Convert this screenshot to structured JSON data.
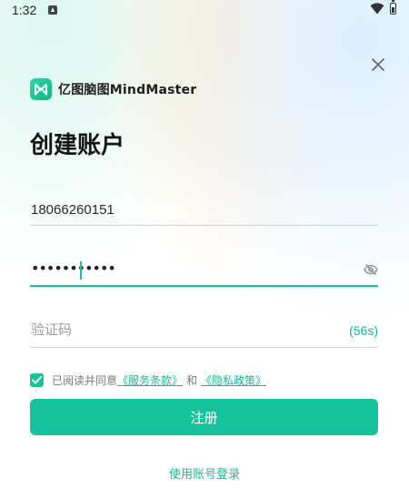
{
  "status_bar": {
    "time": "1:32",
    "icons": [
      "notification-icon",
      "wifi-icon",
      "battery-icon"
    ]
  },
  "header": {
    "close_icon": "close-icon",
    "logo_text": "亿图脑图MindMaster",
    "logo_icon": "mindmaster-logo-icon"
  },
  "title": "创建账户",
  "phone": {
    "value": "18066260151"
  },
  "password": {
    "masked_value": "•••••••••••",
    "toggle_icon": "eye-off-icon"
  },
  "verification": {
    "placeholder": "验证码",
    "countdown": "(56s)"
  },
  "agreement": {
    "checked": true,
    "prefix": "已阅读并同意",
    "terms": "《服务条款》",
    "and": "和",
    "privacy": "《隐私政策》"
  },
  "register_label": "注册",
  "account_login_label": "使用账号登录",
  "colors": {
    "accent": "#17c39d",
    "link": "#19b894",
    "text": "#1f1f1f",
    "muted": "#9a9a9a"
  }
}
